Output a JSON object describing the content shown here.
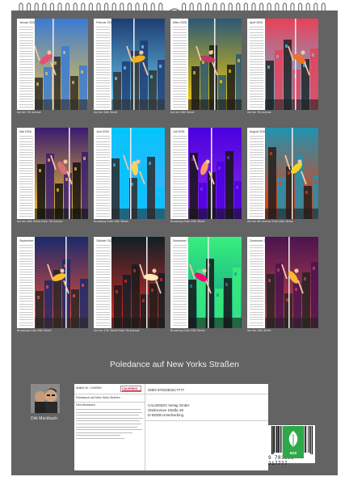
{
  "title": "Poledance auf New Yorks Straßen",
  "author": "Dirk Meckbach",
  "months": [
    {
      "name": "Januar 2026",
      "caption": "Auf der 7th Avenue"
    },
    {
      "name": "Februar 2026",
      "caption": "Auf der 45th Street"
    },
    {
      "name": "März 2026",
      "caption": "Auf der 45th Street"
    },
    {
      "name": "April 2026",
      "caption": "Auf der 7th Avenue"
    },
    {
      "name": "Mai 2026",
      "caption": "Auf der 46th Street Ecke 7th Avenue"
    },
    {
      "name": "Juni 2026",
      "caption": "Broadway Ecke 44th Street"
    },
    {
      "name": "Juli 2026",
      "caption": "Broadway Ecke 43th Street"
    },
    {
      "name": "August 2026",
      "caption": "Auf der 8th Avenue Ecke 40th Street"
    },
    {
      "name": "September 2026",
      "caption": "Broadway Ecke 45th Street"
    },
    {
      "name": "Oktober 2026",
      "caption": "Auf der 47th Street Ecke 7th Avenue"
    },
    {
      "name": "November 2026",
      "caption": "Broadway Ecke 42th Street"
    },
    {
      "name": "Dezember 2026",
      "caption": "Auf der 43th Street"
    }
  ],
  "info": {
    "article_no": "Artikel Nr.: 1094592",
    "product_title": "Poledance auf New Yorks Straßen",
    "author_line": "Dirk Meckbach",
    "isbn": "ISBN 9783383217777",
    "publisher_lines": [
      "CALVENDO Verlag GmbH",
      "Ottobrunner Straße 39",
      "D-82008 Unterhaching"
    ],
    "logo_text": "CALVENDO",
    "barcode_digits": "9 783383 217777"
  },
  "eco_label": "eco",
  "colors": {
    "sheet": "#636363",
    "eco": "#2ea84a",
    "calvendo": "#c8102e"
  }
}
